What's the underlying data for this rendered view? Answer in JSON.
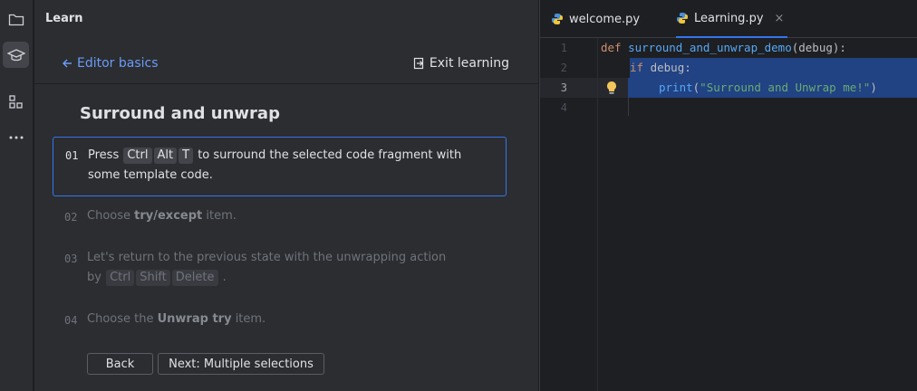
{
  "panel": {
    "title": "Learn"
  },
  "nav": {
    "back_label": "Editor basics",
    "exit_label": "Exit learning"
  },
  "lesson": {
    "title": "Surround and unwrap",
    "steps": [
      {
        "num": "01",
        "pre": "Press",
        "keys": [
          "Ctrl",
          "Alt",
          "T"
        ],
        "post": "to surround the selected code fragment with",
        "line2": "some template code."
      },
      {
        "num": "02",
        "pre": "Choose",
        "bold": "try/except",
        "post": "item."
      },
      {
        "num": "03",
        "line1": "Let's return to the previous state with the unwrapping action",
        "pre2": "by",
        "keys": [
          "Ctrl",
          "Shift",
          "Delete"
        ],
        "post2": "."
      },
      {
        "num": "04",
        "pre": "Choose the",
        "bold": "Unwrap try",
        "post": "item."
      }
    ]
  },
  "buttons": {
    "back": "Back",
    "next": "Next: Multiple selections"
  },
  "tabs": [
    {
      "label": "welcome.py",
      "selected": false
    },
    {
      "label": "Learning.py",
      "selected": true,
      "close": "×"
    }
  ],
  "editor": {
    "line_numbers": [
      "1",
      "2",
      "3",
      "4"
    ],
    "current_line": 3,
    "code": {
      "l1_kw": "def",
      "l1_fn": "surround_and_unwrap_demo",
      "l1_rest": "(debug):",
      "l2_kw": "if",
      "l2_rest": " debug:",
      "l3_fn": "print",
      "l3_open": "(",
      "l3_str": "\"Surround and Unwrap me!\"",
      "l3_close": ")"
    }
  },
  "colors": {
    "accent": "#3574f0",
    "link": "#6b9bfa",
    "selection": "#214283",
    "keyword": "#cf8e6d",
    "function": "#56a8f5",
    "string": "#6aab73"
  }
}
